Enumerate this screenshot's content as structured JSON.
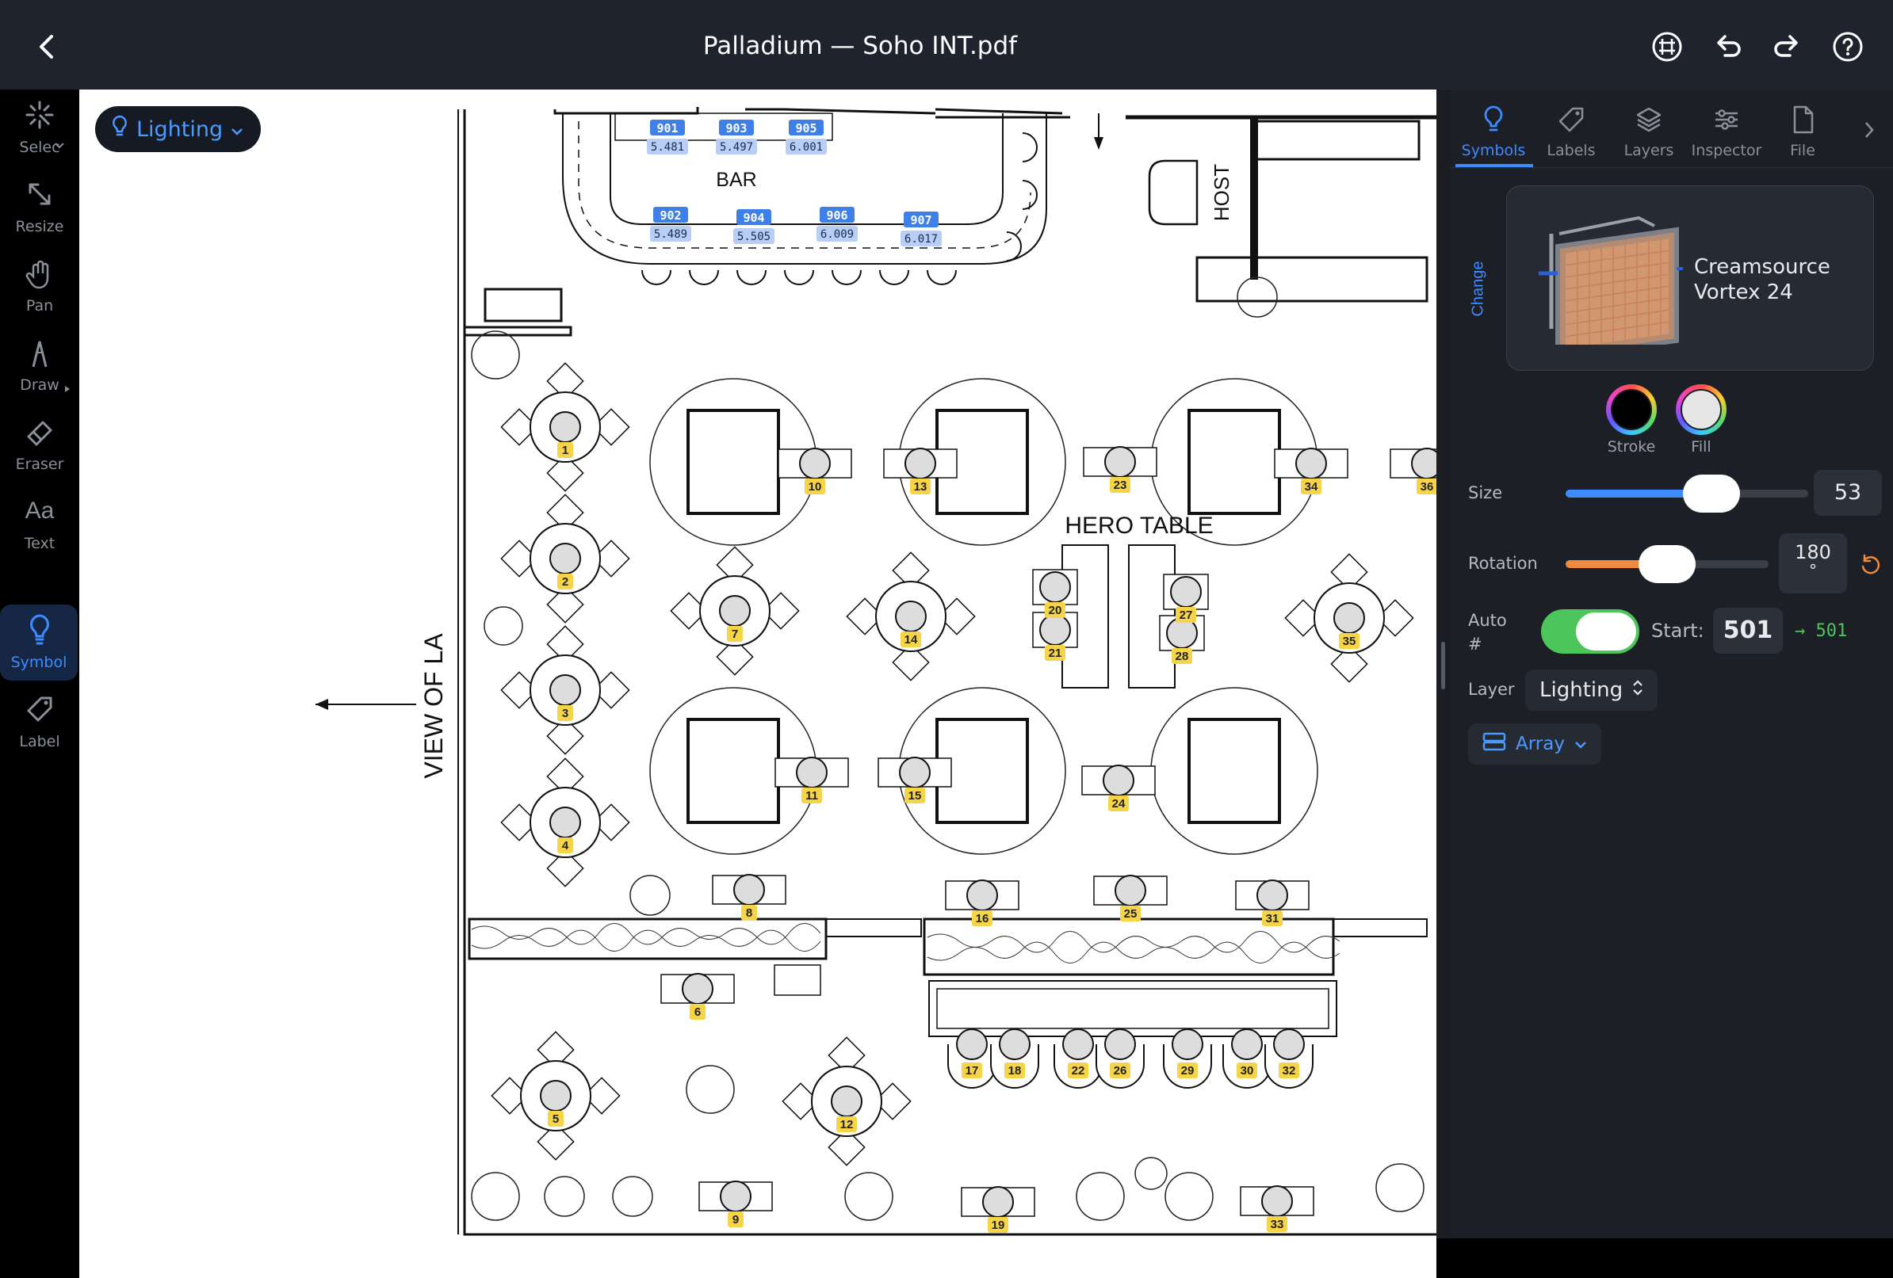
{
  "topbar": {
    "title": "Palladium — Soho INT.pdf"
  },
  "toolbar": {
    "tools": [
      {
        "label": "Selec",
        "icon": "select-icon"
      },
      {
        "label": "Resize",
        "icon": "resize-icon"
      },
      {
        "label": "Pan",
        "icon": "pan-icon"
      },
      {
        "label": "Draw",
        "icon": "draw-icon"
      },
      {
        "label": "Eraser",
        "icon": "eraser-icon"
      },
      {
        "label": "Text",
        "icon": "text-icon"
      },
      {
        "label": "Symbol",
        "icon": "symbol-icon",
        "active": true
      },
      {
        "label": "Label",
        "icon": "label-icon"
      }
    ],
    "text_glyph": "Aa"
  },
  "canvas": {
    "layer_pill": "Lighting",
    "plan_labels": {
      "bar": "BAR",
      "host": "HOST",
      "hero_table": "HERO TABLE",
      "view_of_la": "VIEW OF LA"
    },
    "bar_fixtures": [
      {
        "id": "901",
        "value": "5.481"
      },
      {
        "id": "903",
        "value": "5.497"
      },
      {
        "id": "905",
        "value": "6.001"
      },
      {
        "id": "902",
        "value": "5.489"
      },
      {
        "id": "904",
        "value": "5.505"
      },
      {
        "id": "906",
        "value": "6.009"
      },
      {
        "id": "907",
        "value": "6.017"
      }
    ],
    "table_numbers": [
      "1",
      "2",
      "3",
      "4",
      "5",
      "6",
      "7",
      "8",
      "9",
      "10",
      "11",
      "12",
      "13",
      "14",
      "15",
      "16",
      "17",
      "18",
      "19",
      "20",
      "21",
      "22",
      "23",
      "24",
      "25",
      "26",
      "27",
      "28",
      "29",
      "30",
      "31",
      "32",
      "33",
      "34",
      "35",
      "36"
    ]
  },
  "panel": {
    "tabs": [
      {
        "label": "Symbols",
        "icon": "bulb-icon",
        "active": true
      },
      {
        "label": "Labels",
        "icon": "tag-icon"
      },
      {
        "label": "Layers",
        "icon": "layers-icon"
      },
      {
        "label": "Inspector",
        "icon": "sliders-icon"
      },
      {
        "label": "File",
        "icon": "file-icon"
      }
    ],
    "change_label": "Change",
    "symbol_name": "Creamsource Vortex 24",
    "stroke_label": "Stroke",
    "fill_label": "Fill",
    "stroke_color": "#000000",
    "fill_color": "#e6e6e6",
    "size_label": "Size",
    "size_value": "53",
    "size_fraction": 0.6,
    "rotation_label": "Rotation",
    "rotation_value": "180",
    "rotation_unit": "°",
    "rotation_fraction": 0.5,
    "auto_label": "Auto",
    "auto_hash": "#",
    "auto_enabled": true,
    "start_label": "Start:",
    "start_value": "501",
    "next_preview": "→ 501",
    "layer_label": "Layer",
    "layer_value": "Lighting",
    "array_label": "Array"
  },
  "colors": {
    "accent": "#3d8bff",
    "toggle_on": "#4cc65a",
    "rotation": "#f08a3c",
    "badge_yellow": "#f5d547",
    "badge_blue": "#3f7fe8"
  }
}
